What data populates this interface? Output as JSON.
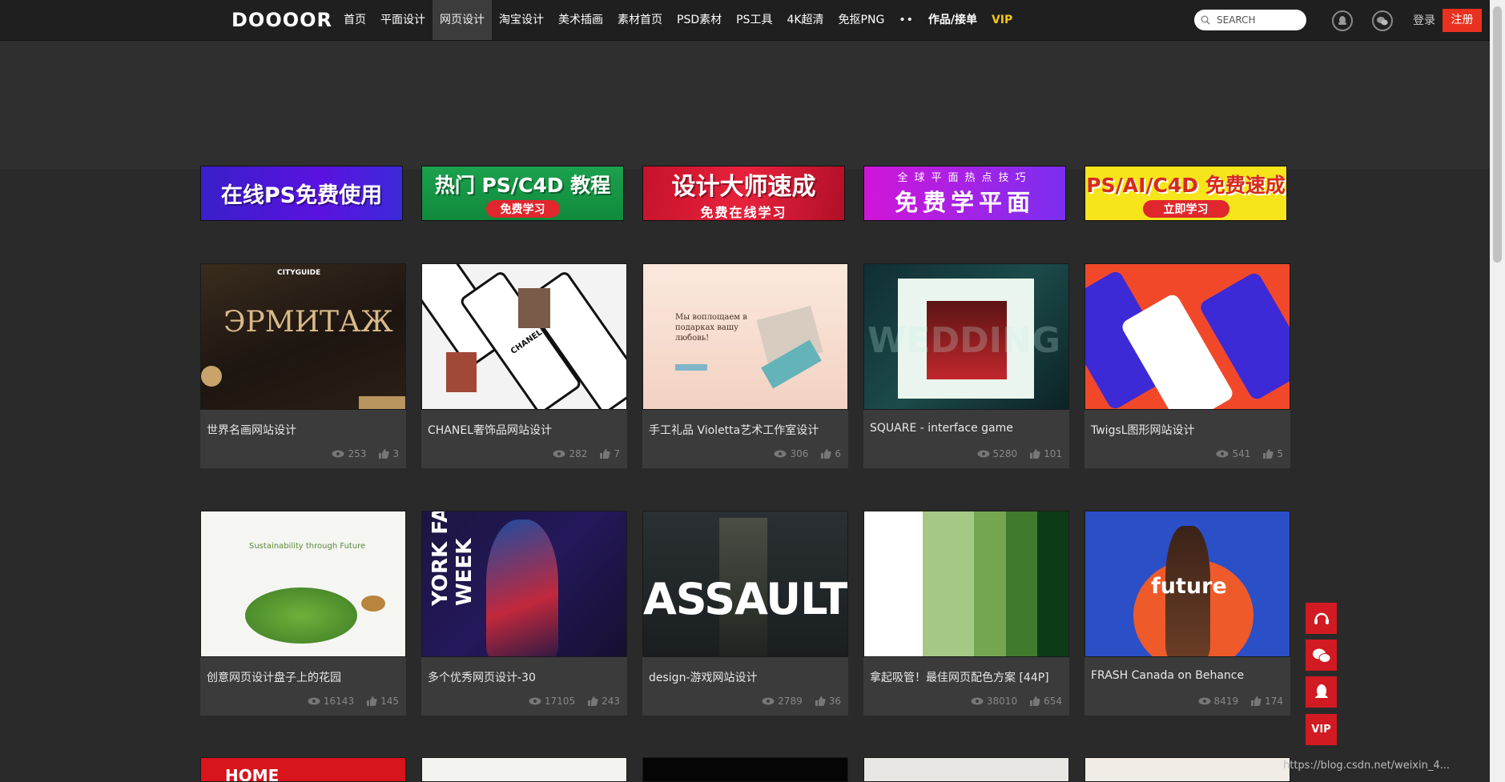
{
  "header": {
    "logo": "DOOOOR",
    "nav": [
      "首页",
      "平面设计",
      "网页设计",
      "淘宝设计",
      "美术插画",
      "素材首页",
      "PSD素材",
      "PS工具",
      "4K超清",
      "免抠PNG",
      "••",
      "作品/接单",
      "VIP"
    ],
    "active_nav": "网页设计",
    "search_placeholder": "SEARCH",
    "login": "登录",
    "register": "注册"
  },
  "banners": [
    {
      "text": "在线PS免费使用"
    },
    {
      "text": "热门 PS/C4D 教程",
      "button": "免费学习"
    },
    {
      "text": "设计大师速成",
      "sub": "免费在线学习"
    },
    {
      "top": "全球平面热点技巧",
      "text": "免费学平面"
    },
    {
      "text": "PS/AI/C4D 免费速成",
      "button": "立即学习"
    }
  ],
  "cards": [
    {
      "title": "世界名画网站设计",
      "views": "253",
      "likes": "3",
      "thumb_text": "ЭРМИТАЖ",
      "thumb_label": "CITYGUIDE"
    },
    {
      "title": "CHANEL奢饰品网站设计",
      "views": "282",
      "likes": "7",
      "thumb_text": "CHANEL"
    },
    {
      "title": "手工礼品 Violetta艺术工作室设计",
      "views": "306",
      "likes": "6",
      "thumb_text": "Мы воплощаем в подарках вашу любовь!"
    },
    {
      "title": "SQUARE - interface game",
      "views": "5280",
      "likes": "101",
      "thumb_text": "WEDDING"
    },
    {
      "title": "TwigsL图形网站设计",
      "views": "541",
      "likes": "5"
    },
    {
      "title": "创意网页设计盘子上的花园",
      "views": "16143",
      "likes": "145",
      "thumb_text": "Sustainability through Future"
    },
    {
      "title": "多个优秀网页设计-30",
      "views": "17105",
      "likes": "243",
      "thumb_text": "YORK FASHION WEEK"
    },
    {
      "title": "design-游戏网站设计",
      "views": "2789",
      "likes": "36",
      "thumb_text": "ASSAULT"
    },
    {
      "title": "拿起吸管！最佳网页配色方案 [44P]",
      "views": "38010",
      "likes": "654"
    },
    {
      "title": "FRASH Canada on Behance",
      "views": "8419",
      "likes": "174",
      "thumb_text": "future"
    }
  ],
  "third_row": [
    {
      "thumb_text": "HOME"
    },
    {},
    {},
    {},
    {}
  ],
  "side_buttons": [
    "headset",
    "wechat",
    "qq",
    "VIP"
  ],
  "watermark": "https://blog.csdn.net/weixin_4..."
}
